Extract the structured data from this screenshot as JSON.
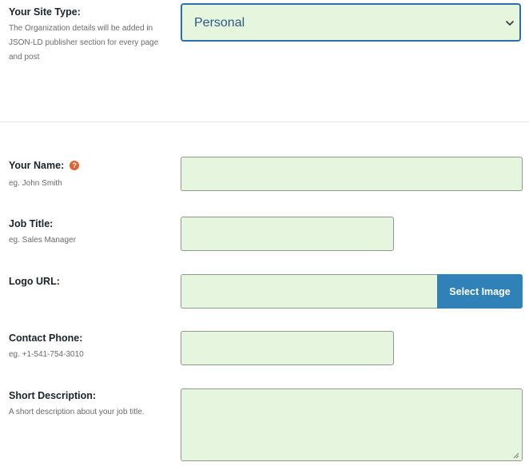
{
  "site_type": {
    "label": "Your Site Type:",
    "hint": "The Organization details will be added in JSON-LD publisher section for every page and post",
    "selected": "Personal",
    "chevron_icon": "chevron-down-icon"
  },
  "fields": {
    "name": {
      "label": "Your Name:",
      "hint": "eg. John Smith",
      "value": "",
      "help_icon": "question-mark-icon",
      "help_glyph": "?"
    },
    "job_title": {
      "label": "Job Title:",
      "hint": "eg. Sales Manager",
      "value": ""
    },
    "logo_url": {
      "label": "Logo URL:",
      "value": "",
      "button_label": "Select Image"
    },
    "contact_phone": {
      "label": "Contact Phone:",
      "hint": "eg. +1-541-754-3010",
      "value": ""
    },
    "short_description": {
      "label": "Short Description:",
      "hint": "A short description about your job title.",
      "value": ""
    }
  },
  "colors": {
    "input_background": "#e6f5dd",
    "accent": "#2f81b7",
    "help_icon": "#e2632f"
  }
}
